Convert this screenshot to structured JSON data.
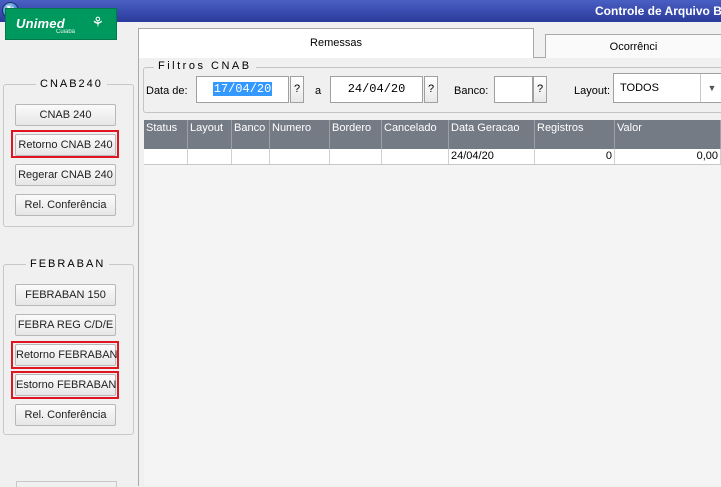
{
  "window": {
    "title": "Controle de Arquivo Ba"
  },
  "logo": {
    "brand": "Unimed",
    "sub": "Cuiabá"
  },
  "cnab240": {
    "title": "CNAB240",
    "buttons": [
      "CNAB 240",
      "Retorno CNAB 240",
      "Regerar CNAB 240",
      "Rel. Conferência"
    ]
  },
  "febraban": {
    "title": "FEBRABAN",
    "buttons": [
      "FEBRABAN 150",
      "FEBRA REG C/D/E",
      "Retorno FEBRABAN",
      "Estorno FEBRABAN",
      "Rel. Conferência"
    ]
  },
  "tabs": [
    {
      "label": "Remessas",
      "active": true
    },
    {
      "label": "Ocorrênci",
      "active": false
    }
  ],
  "filters": {
    "title": "Filtros CNAB",
    "date_label": "Data de:",
    "date_from": "17/04/20",
    "between_label": "a",
    "date_to": "24/04/20",
    "bank_label": "Banco:",
    "bank_value": "",
    "lookup": "?",
    "layout_label": "Layout:",
    "layout_value": "TODOS"
  },
  "grid": {
    "columns": [
      "Status",
      "Layout",
      "Banco",
      "Numero",
      "Bordero",
      "Cancelado",
      "Data Geracao",
      "Registros",
      "Valor"
    ],
    "rows": [
      [
        "",
        "",
        "",
        "",
        "",
        "",
        "24/04/20",
        "0",
        "0,00"
      ]
    ]
  },
  "colors": {
    "highlight": "#e0151f",
    "titlebar": "#2a3b9a",
    "grid_header": "#757b85",
    "logo": "#00995d"
  }
}
